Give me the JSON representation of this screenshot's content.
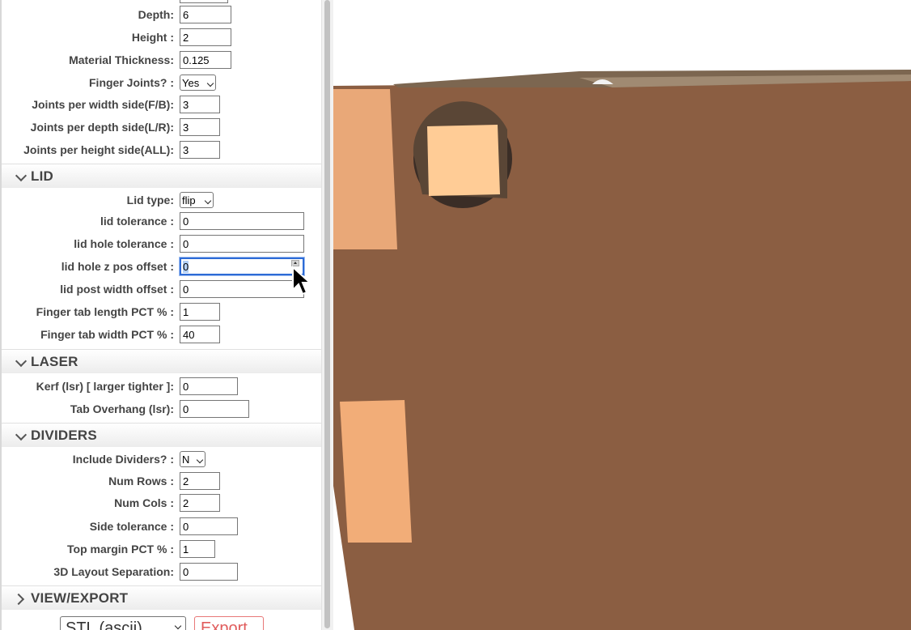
{
  "general": {
    "depth_label": "Depth:",
    "depth_value": "6",
    "height_label": "Height :",
    "height_value": "2",
    "material_label": "Material Thickness:",
    "material_value": "0.125",
    "finger_joints_label": "Finger Joints? :",
    "finger_joints_value": "Yes",
    "jw_label": "Joints per width side(F/B):",
    "jw_value": "3",
    "jd_label": "Joints per depth side(L/R):",
    "jd_value": "3",
    "jh_label": "Joints per height side(ALL):",
    "jh_value": "3"
  },
  "lid": {
    "title": "LID",
    "type_label": "Lid type:",
    "type_value": "flip",
    "tol_label": "lid tolerance :",
    "tol_value": "0",
    "hole_tol_label": "lid hole tolerance :",
    "hole_tol_value": "0",
    "hole_z_label": "lid hole z pos offset :",
    "hole_z_value": "0",
    "post_w_label": "lid post width offset :",
    "post_w_value": "0",
    "tab_len_label": "Finger tab length PCT % :",
    "tab_len_value": "1",
    "tab_w_label": "Finger tab width PCT % :",
    "tab_w_value": "40"
  },
  "laser": {
    "title": "LASER",
    "kerf_label": "Kerf (lsr) [ larger tighter ]:",
    "kerf_value": "0",
    "overhang_label": "Tab Overhang (lsr):",
    "overhang_value": "0"
  },
  "dividers": {
    "title": "DIVIDERS",
    "include_label": "Include Dividers? :",
    "include_value": "N",
    "rows_label": "Num Rows :",
    "rows_value": "2",
    "cols_label": "Num Cols :",
    "cols_value": "2",
    "side_tol_label": "Side tolerance :",
    "side_tol_value": "0",
    "top_margin_label": "Top margin PCT % :",
    "top_margin_value": "1",
    "layout_sep_label": "3D Layout Separation:",
    "layout_sep_value": "0"
  },
  "view_export": {
    "title": "VIEW/EXPORT",
    "format_value": "STL (ascii)",
    "export_label": "Export"
  },
  "colors": {
    "box_face": "#8b5e42",
    "tab_face": "#f0a870",
    "accent_focus": "#2d6bd6"
  }
}
